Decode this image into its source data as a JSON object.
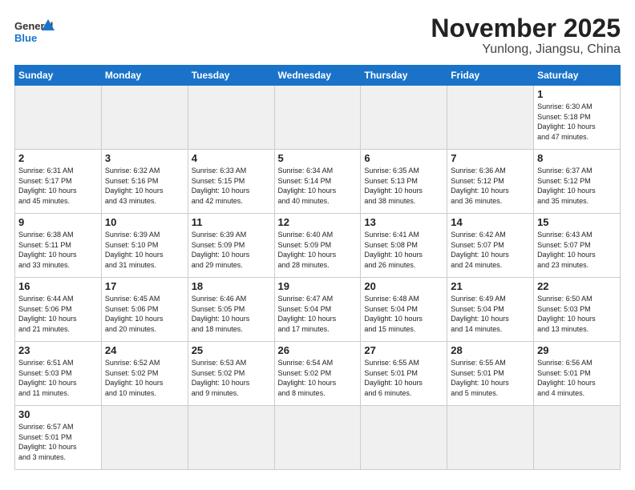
{
  "header": {
    "logo_general": "General",
    "logo_blue": "Blue",
    "month_title": "November 2025",
    "location": "Yunlong, Jiangsu, China"
  },
  "days_of_week": [
    "Sunday",
    "Monday",
    "Tuesday",
    "Wednesday",
    "Thursday",
    "Friday",
    "Saturday"
  ],
  "weeks": [
    [
      {
        "day": "",
        "info": "",
        "empty": true
      },
      {
        "day": "",
        "info": "",
        "empty": true
      },
      {
        "day": "",
        "info": "",
        "empty": true
      },
      {
        "day": "",
        "info": "",
        "empty": true
      },
      {
        "day": "",
        "info": "",
        "empty": true
      },
      {
        "day": "",
        "info": "",
        "empty": true
      },
      {
        "day": "1",
        "info": "Sunrise: 6:30 AM\nSunset: 5:18 PM\nDaylight: 10 hours\nand 47 minutes."
      }
    ],
    [
      {
        "day": "2",
        "info": "Sunrise: 6:31 AM\nSunset: 5:17 PM\nDaylight: 10 hours\nand 45 minutes."
      },
      {
        "day": "3",
        "info": "Sunrise: 6:32 AM\nSunset: 5:16 PM\nDaylight: 10 hours\nand 43 minutes."
      },
      {
        "day": "4",
        "info": "Sunrise: 6:33 AM\nSunset: 5:15 PM\nDaylight: 10 hours\nand 42 minutes."
      },
      {
        "day": "5",
        "info": "Sunrise: 6:34 AM\nSunset: 5:14 PM\nDaylight: 10 hours\nand 40 minutes."
      },
      {
        "day": "6",
        "info": "Sunrise: 6:35 AM\nSunset: 5:13 PM\nDaylight: 10 hours\nand 38 minutes."
      },
      {
        "day": "7",
        "info": "Sunrise: 6:36 AM\nSunset: 5:12 PM\nDaylight: 10 hours\nand 36 minutes."
      },
      {
        "day": "8",
        "info": "Sunrise: 6:37 AM\nSunset: 5:12 PM\nDaylight: 10 hours\nand 35 minutes."
      }
    ],
    [
      {
        "day": "9",
        "info": "Sunrise: 6:38 AM\nSunset: 5:11 PM\nDaylight: 10 hours\nand 33 minutes."
      },
      {
        "day": "10",
        "info": "Sunrise: 6:39 AM\nSunset: 5:10 PM\nDaylight: 10 hours\nand 31 minutes."
      },
      {
        "day": "11",
        "info": "Sunrise: 6:39 AM\nSunset: 5:09 PM\nDaylight: 10 hours\nand 29 minutes."
      },
      {
        "day": "12",
        "info": "Sunrise: 6:40 AM\nSunset: 5:09 PM\nDaylight: 10 hours\nand 28 minutes."
      },
      {
        "day": "13",
        "info": "Sunrise: 6:41 AM\nSunset: 5:08 PM\nDaylight: 10 hours\nand 26 minutes."
      },
      {
        "day": "14",
        "info": "Sunrise: 6:42 AM\nSunset: 5:07 PM\nDaylight: 10 hours\nand 24 minutes."
      },
      {
        "day": "15",
        "info": "Sunrise: 6:43 AM\nSunset: 5:07 PM\nDaylight: 10 hours\nand 23 minutes."
      }
    ],
    [
      {
        "day": "16",
        "info": "Sunrise: 6:44 AM\nSunset: 5:06 PM\nDaylight: 10 hours\nand 21 minutes."
      },
      {
        "day": "17",
        "info": "Sunrise: 6:45 AM\nSunset: 5:06 PM\nDaylight: 10 hours\nand 20 minutes."
      },
      {
        "day": "18",
        "info": "Sunrise: 6:46 AM\nSunset: 5:05 PM\nDaylight: 10 hours\nand 18 minutes."
      },
      {
        "day": "19",
        "info": "Sunrise: 6:47 AM\nSunset: 5:04 PM\nDaylight: 10 hours\nand 17 minutes."
      },
      {
        "day": "20",
        "info": "Sunrise: 6:48 AM\nSunset: 5:04 PM\nDaylight: 10 hours\nand 15 minutes."
      },
      {
        "day": "21",
        "info": "Sunrise: 6:49 AM\nSunset: 5:04 PM\nDaylight: 10 hours\nand 14 minutes."
      },
      {
        "day": "22",
        "info": "Sunrise: 6:50 AM\nSunset: 5:03 PM\nDaylight: 10 hours\nand 13 minutes."
      }
    ],
    [
      {
        "day": "23",
        "info": "Sunrise: 6:51 AM\nSunset: 5:03 PM\nDaylight: 10 hours\nand 11 minutes."
      },
      {
        "day": "24",
        "info": "Sunrise: 6:52 AM\nSunset: 5:02 PM\nDaylight: 10 hours\nand 10 minutes."
      },
      {
        "day": "25",
        "info": "Sunrise: 6:53 AM\nSunset: 5:02 PM\nDaylight: 10 hours\nand 9 minutes."
      },
      {
        "day": "26",
        "info": "Sunrise: 6:54 AM\nSunset: 5:02 PM\nDaylight: 10 hours\nand 8 minutes."
      },
      {
        "day": "27",
        "info": "Sunrise: 6:55 AM\nSunset: 5:01 PM\nDaylight: 10 hours\nand 6 minutes."
      },
      {
        "day": "28",
        "info": "Sunrise: 6:55 AM\nSunset: 5:01 PM\nDaylight: 10 hours\nand 5 minutes."
      },
      {
        "day": "29",
        "info": "Sunrise: 6:56 AM\nSunset: 5:01 PM\nDaylight: 10 hours\nand 4 minutes."
      }
    ],
    [
      {
        "day": "30",
        "info": "Sunrise: 6:57 AM\nSunset: 5:01 PM\nDaylight: 10 hours\nand 3 minutes."
      },
      {
        "day": "",
        "info": "",
        "empty": true
      },
      {
        "day": "",
        "info": "",
        "empty": true
      },
      {
        "day": "",
        "info": "",
        "empty": true
      },
      {
        "day": "",
        "info": "",
        "empty": true
      },
      {
        "day": "",
        "info": "",
        "empty": true
      },
      {
        "day": "",
        "info": "",
        "empty": true
      }
    ]
  ]
}
